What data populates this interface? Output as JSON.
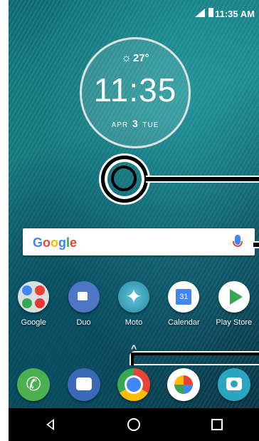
{
  "status_bar": {
    "time": "11:35 AM"
  },
  "clock_widget": {
    "temperature": "27°",
    "time": "11:35",
    "month": "APR",
    "day": "3",
    "weekday": "TUE"
  },
  "search_bar": {
    "logo_letters": [
      "G",
      "o",
      "o",
      "g",
      "l",
      "e"
    ],
    "mic_icon": "mic-icon"
  },
  "apps_row": [
    {
      "label": "Google",
      "icon": "google-folder-icon"
    },
    {
      "label": "Duo",
      "icon": "duo-icon"
    },
    {
      "label": "Moto",
      "icon": "moto-icon"
    },
    {
      "label": "Calendar",
      "icon": "calendar-icon"
    },
    {
      "label": "Play Store",
      "icon": "play-store-icon"
    }
  ],
  "app_drawer_handle": "^",
  "dock": [
    {
      "icon": "phone-icon"
    },
    {
      "icon": "messages-icon"
    },
    {
      "icon": "chrome-icon"
    },
    {
      "icon": "photos-icon"
    },
    {
      "icon": "camera-icon"
    }
  ],
  "nav_bar": {
    "back": "back-icon",
    "home": "home-icon",
    "recents": "recents-icon"
  },
  "colors": {
    "wallpaper": "#0f6f79",
    "navbar": "#000000",
    "search_bg": "#ffffff"
  }
}
